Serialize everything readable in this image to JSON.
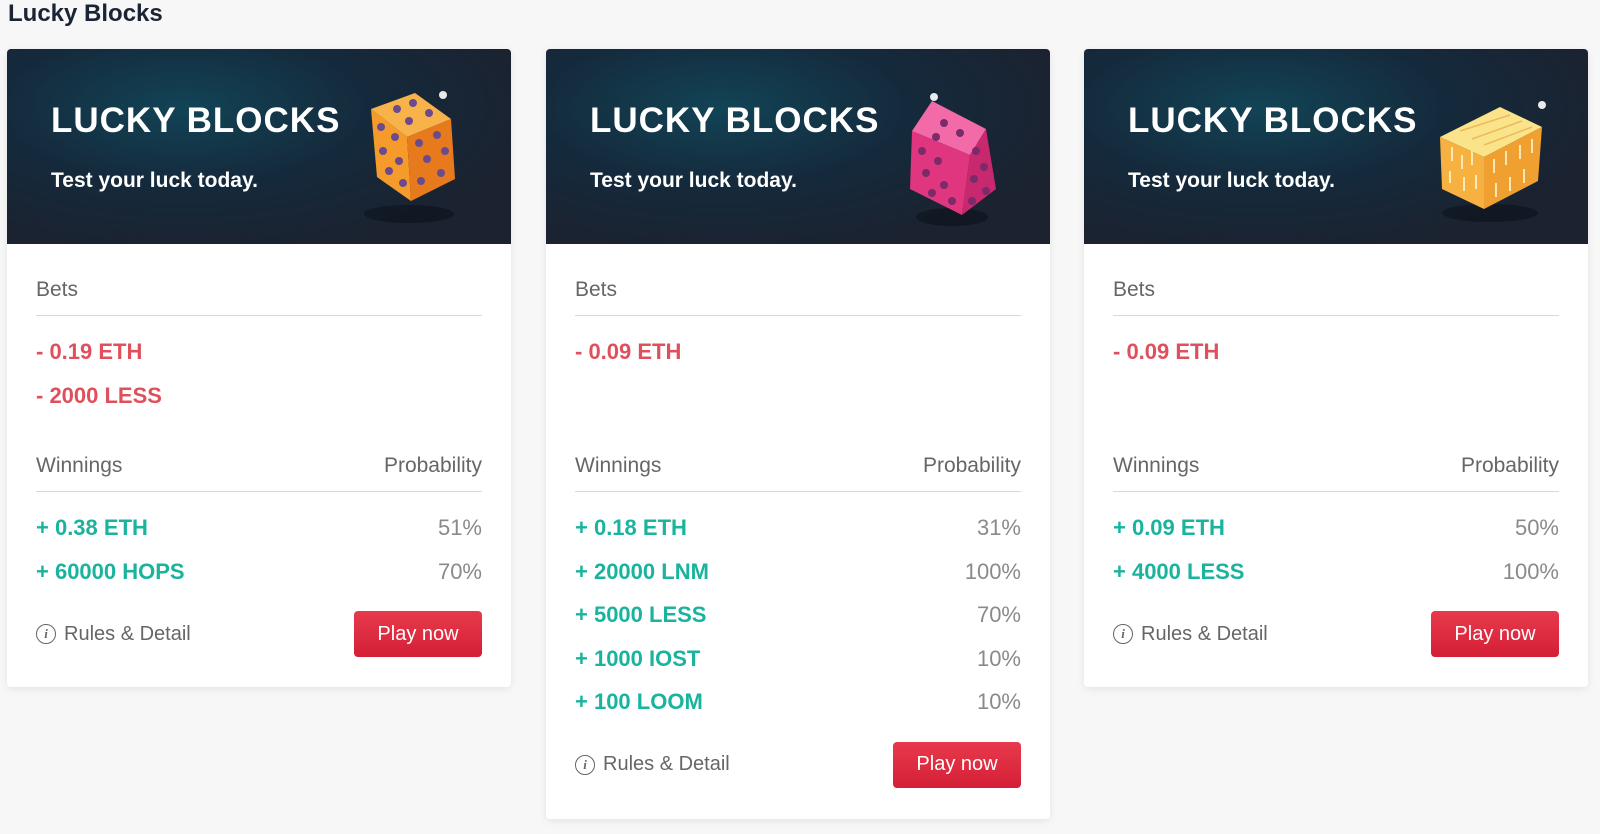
{
  "page": {
    "title": "Lucky Blocks"
  },
  "colors": {
    "bet": "#e0505c",
    "win": "#19b39e",
    "button": "#d41f36",
    "banner": "#1b2230"
  },
  "cards": [
    {
      "banner_title": "LUCKY BLOCKS",
      "banner_subtitle": "Test your luck today.",
      "cube_icon": "orange-dice-cube-icon",
      "bets_label": "Bets",
      "bets": [
        "- 0.19 ETH",
        "- 2000 LESS"
      ],
      "winnings_label": "Winnings",
      "probability_label": "Probability",
      "winnings": [
        {
          "amount": "+ 0.38 ETH",
          "probability": "51%"
        },
        {
          "amount": "+ 60000 HOPS",
          "probability": "70%"
        }
      ],
      "rules_label": "Rules & Detail",
      "play_label": "Play now"
    },
    {
      "banner_title": "LUCKY BLOCKS",
      "banner_subtitle": "Test your luck today.",
      "cube_icon": "pink-dice-cube-icon",
      "bets_label": "Bets",
      "bets": [
        "- 0.09 ETH"
      ],
      "winnings_label": "Winnings",
      "probability_label": "Probability",
      "winnings": [
        {
          "amount": "+ 0.18 ETH",
          "probability": "31%"
        },
        {
          "amount": "+ 20000 LNM",
          "probability": "100%"
        },
        {
          "amount": "+ 5000 LESS",
          "probability": "70%"
        },
        {
          "amount": "+ 1000 IOST",
          "probability": "10%"
        },
        {
          "amount": "+ 100 LOOM",
          "probability": "10%"
        }
      ],
      "rules_label": "Rules & Detail",
      "play_label": "Play now"
    },
    {
      "banner_title": "LUCKY BLOCKS",
      "banner_subtitle": "Test your luck today.",
      "cube_icon": "yellow-brick-cube-icon",
      "bets_label": "Bets",
      "bets": [
        "- 0.09 ETH"
      ],
      "winnings_label": "Winnings",
      "probability_label": "Probability",
      "winnings": [
        {
          "amount": "+ 0.09 ETH",
          "probability": "50%"
        },
        {
          "amount": "+ 4000 LESS",
          "probability": "100%"
        }
      ],
      "rules_label": "Rules & Detail",
      "play_label": "Play now"
    }
  ]
}
